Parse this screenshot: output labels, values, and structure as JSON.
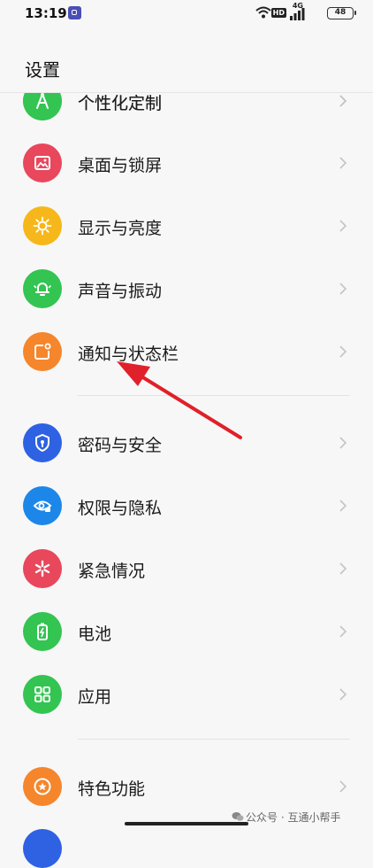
{
  "status_bar": {
    "time": "13:19",
    "network": "4G",
    "battery": "48"
  },
  "header": {
    "title": "设置"
  },
  "rows": [
    {
      "label": "个性化定制",
      "color": "#33c451",
      "icon": "compass-icon"
    },
    {
      "label": "桌面与锁屏",
      "color": "#e8475c",
      "icon": "picture-icon"
    },
    {
      "label": "显示与亮度",
      "color": "#f6b71a",
      "icon": "sun-icon"
    },
    {
      "label": "声音与振动",
      "color": "#33c451",
      "icon": "bell-icon"
    },
    {
      "label": "通知与状态栏",
      "color": "#f5862c",
      "icon": "notification-icon"
    },
    {
      "label": "密码与安全",
      "color": "#2e62e3",
      "icon": "shield-icon"
    },
    {
      "label": "权限与隐私",
      "color": "#1c87e8",
      "icon": "eye-lock-icon"
    },
    {
      "label": "紧急情况",
      "color": "#e8475c",
      "icon": "asterisk-icon"
    },
    {
      "label": "电池",
      "color": "#33c451",
      "icon": "battery-icon"
    },
    {
      "label": "应用",
      "color": "#33c451",
      "icon": "apps-grid-icon"
    },
    {
      "label": "特色功能",
      "color": "#f5862c",
      "icon": "star-icon"
    }
  ],
  "watermark": "公众号 · 互通小帮手",
  "annotation": {
    "color": "#e0202a"
  }
}
